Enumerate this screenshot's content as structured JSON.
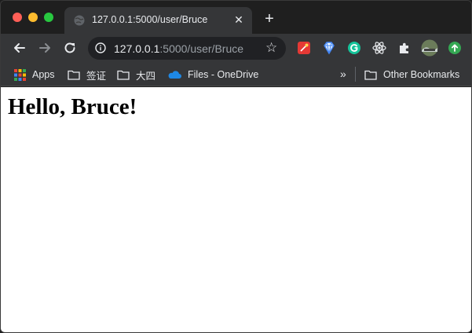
{
  "tab": {
    "title": "127.0.0.1:5000/user/Bruce",
    "close_glyph": "✕"
  },
  "toolbar": {
    "url_host": "127.0.0.1",
    "url_rest": ":5000/user/Bruce",
    "new_tab_glyph": "+",
    "star_glyph": "☆",
    "extensions": [
      "sparkle-extension-icon",
      "diamond-extension-icon",
      "grammarly-icon",
      "react-devtools-icon",
      "puzzle-extensions-icon",
      "profile-avatar",
      "update-icon"
    ]
  },
  "bookmarks": {
    "apps": "Apps",
    "folder1": "签证",
    "folder2": "大四",
    "onedrive": "Files - OneDrive",
    "overflow": "»",
    "other": "Other Bookmarks"
  },
  "page": {
    "heading": "Hello, Bruce!"
  },
  "colors": {
    "chrome_bg": "#1f1f1f",
    "toolbar_bg": "#353638",
    "omnibox_bg": "#202124",
    "text": "#e8eaed",
    "muted_text": "#9aa0a6"
  }
}
